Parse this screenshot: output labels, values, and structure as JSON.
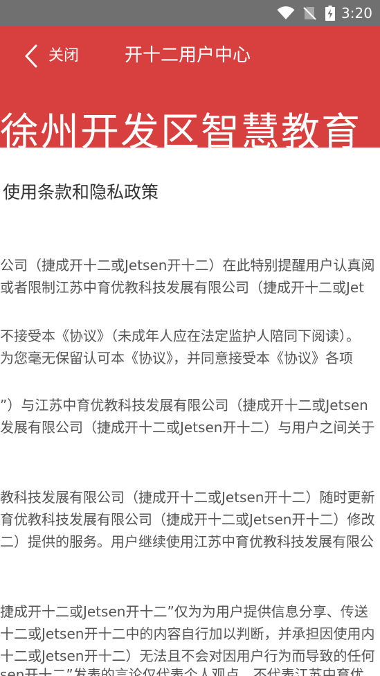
{
  "status_bar": {
    "time": "3:20",
    "icons": [
      "wifi-icon",
      "no-sim-icon",
      "battery-charging-icon"
    ]
  },
  "header": {
    "back_icon": "chevron-left-icon",
    "back_label": "关闭",
    "title": "开十二用户中心"
  },
  "banner": {
    "text": "徐州开发区智慧教育"
  },
  "content": {
    "heading": "使用条款和隐私政策",
    "lines": [
      "公司（捷成开十二或Jetsen开十二）在此特别提醒用户认真阅",
      "或者限制江苏中育优教科技发展有限公司（捷成开十二或Jet",
      "不接受本《协议》（未成年人应在法定监护人陪同下阅读）。",
      "为您毫无保留认可本《协议》，并同意接受本《协议》各项",
      "”）与江苏中育优教科技发展有限公司（捷成开十二或Jetsen",
      "发展有限公司（捷成开十二或Jetsen开十二）与用户之间关于",
      "教科技发展有限公司（捷成开十二或Jetsen开十二）随时更新",
      "育优教科技发展有限公司（捷成开十二或Jetsen开十二）修改",
      "二）提供的服务。用户继续使用江苏中育优教科技发展有限公",
      "捷成开十二或Jetsen开十二”仅为为用户提供信息分享、传送",
      "十二或Jetsen开十二中的内容自行加以判断，并承担因使用内",
      "十二或Jetsen开十二）无法且不会对因用户行为而导致的任何",
      "sen开十二”发表的言论仅代表个人观点，不代表江苏中育优"
    ]
  },
  "colors": {
    "status_bar_bg": "#707070",
    "header_bg": "#d8403f",
    "header_text": "#ffffff",
    "content_bg": "#ffffff",
    "body_text": "#555555",
    "heading_text": "#333333"
  }
}
